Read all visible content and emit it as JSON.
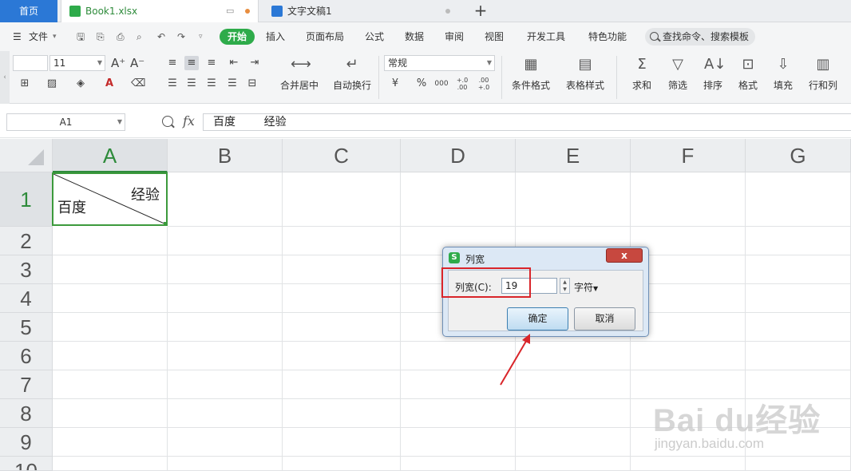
{
  "tabs": {
    "home": "首页",
    "book": "Book1.xlsx",
    "doc": "文字文稿1",
    "new_tab": "+"
  },
  "menu": {
    "file": "文件",
    "items": [
      "开始",
      "插入",
      "页面布局",
      "公式",
      "数据",
      "审阅",
      "视图",
      "开发工具",
      "特色功能"
    ],
    "search": "查找命令、搜索模板"
  },
  "ribbon": {
    "font_name": "",
    "font_size": "11",
    "number_format": "常规",
    "merge": "合并居中",
    "wrap": "自动换行",
    "cond_format": "条件格式",
    "table_style": "表格样式",
    "sum": "求和",
    "filter": "筛选",
    "sort": "排序",
    "format": "格式",
    "fill": "填充",
    "rowcol": "行和列",
    "currency": "¥",
    "percent": "%",
    "thousands": "000",
    "inc_dec": "+.0\n.00",
    "dec_dec": ".00\n+.0"
  },
  "formula_bar": {
    "name_box": "A1",
    "fx": "fx",
    "content": "百度        经验"
  },
  "columns": [
    "A",
    "B",
    "C",
    "D",
    "E",
    "F",
    "G"
  ],
  "rows": [
    "1",
    "2",
    "3",
    "4",
    "5",
    "6",
    "7",
    "8",
    "9",
    "10"
  ],
  "cell_a1": {
    "top_right": "经验",
    "bottom_left": "百度"
  },
  "dialog": {
    "title": "列宽",
    "app_icon": "S",
    "label": "列宽(C):",
    "value": "19",
    "unit": "字符",
    "ok": "确定",
    "cancel": "取消",
    "close": "x"
  },
  "watermark": {
    "brand": "Bai du经验",
    "url": "jingyan.baidu.com"
  },
  "colors": {
    "accent_green": "#2eab4a",
    "selection_green": "#3c9a3c",
    "home_tab_blue": "#2b78d6",
    "annotation_red": "#d9252a"
  }
}
